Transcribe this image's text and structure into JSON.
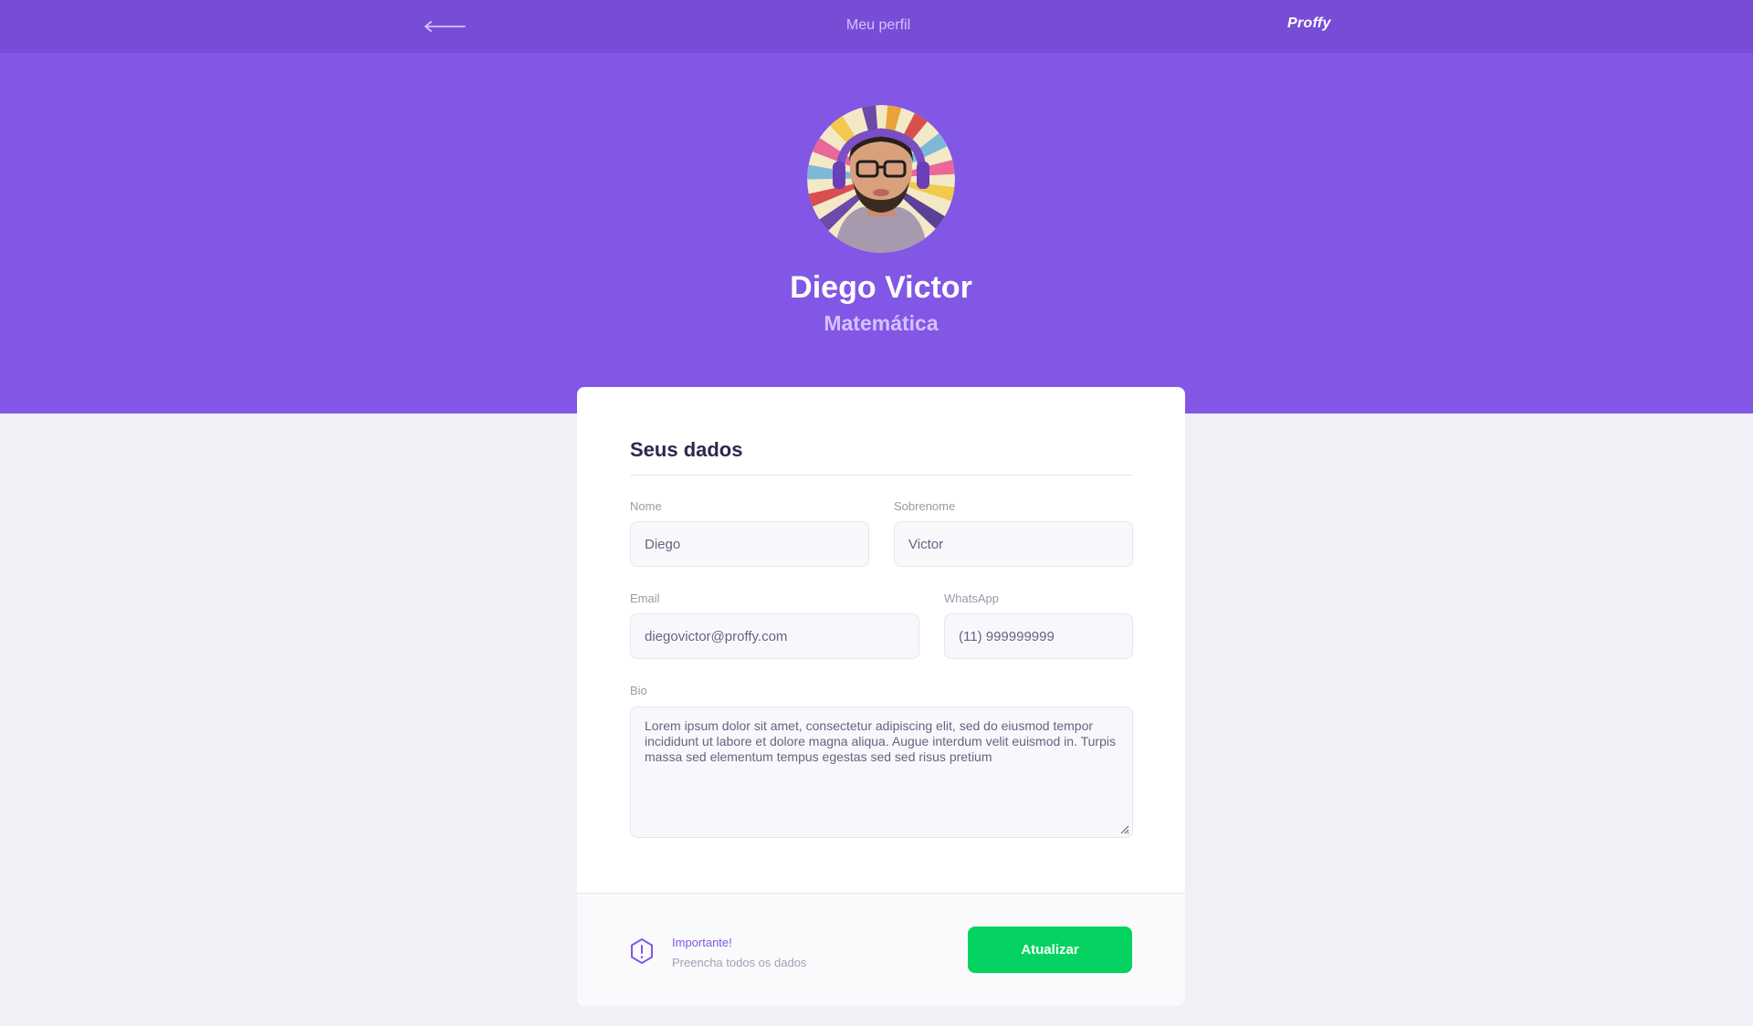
{
  "header": {
    "title": "Meu perfil",
    "logo": "Proffy",
    "back_icon": "arrow-left-icon"
  },
  "profile": {
    "name": "Diego Victor",
    "subject": "Matemática",
    "avatar": "avatar-photo"
  },
  "form": {
    "title": "Seus dados",
    "fields": {
      "first_name": {
        "label": "Nome",
        "value": "Diego"
      },
      "last_name": {
        "label": "Sobrenome",
        "value": "Victor"
      },
      "email": {
        "label": "Email",
        "value": "diegovictor@proffy.com"
      },
      "whatsapp": {
        "label": "WhatsApp",
        "value": "(11) 999999999"
      },
      "bio": {
        "label": "Bio",
        "value": "Lorem ipsum dolor sit amet, consectetur adipiscing elit, sed do eiusmod tempor incididunt ut labore et dolore magna aliqua. Augue interdum velit euismod in. Turpis massa sed elementum tempus egestas sed sed risus pretium"
      }
    }
  },
  "footer": {
    "warning_title": "Importante!",
    "warning_text": "Preencha todos os dados",
    "warning_icon": "warning-icon",
    "submit_label": "Atualizar"
  },
  "colors": {
    "topbar": "#774DD6",
    "primary": "#8257E5",
    "primary_lighter": "#D4C2FF",
    "background": "#F0F0F7",
    "title": "#32264D",
    "text": "#6A6180",
    "secondary": "#04D361"
  }
}
